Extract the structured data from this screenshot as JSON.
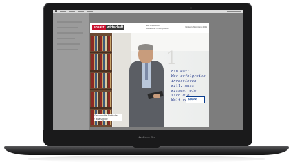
{
  "device": {
    "brand_label": "MacBook Pro"
  },
  "popup": {
    "logo_part1": "absatz",
    "logo_part2": "wirtschaft",
    "header_mid_line1": "Ein Angebot zu",
    "header_mid_line2": "Deutscher Finanzpraxis",
    "header_right": "Wirtschaftszeitung 2011",
    "big_number": "1",
    "quote": "Ein Rat:\nWer erfolgreich\ninvestieren will, muss\nwissen, wie sich die\nWelt verändert.",
    "sponsor_name": "Allianz",
    "sponsor_sub": "Global Investors",
    "footer_line1": "Geschenkte Einblicke",
    "footer_line2": "› allianzgi.de"
  },
  "colors": {
    "logo_red": "#c8102e",
    "quote_blue": "#2a3f8f",
    "allianz_blue": "#0a3e8f"
  }
}
